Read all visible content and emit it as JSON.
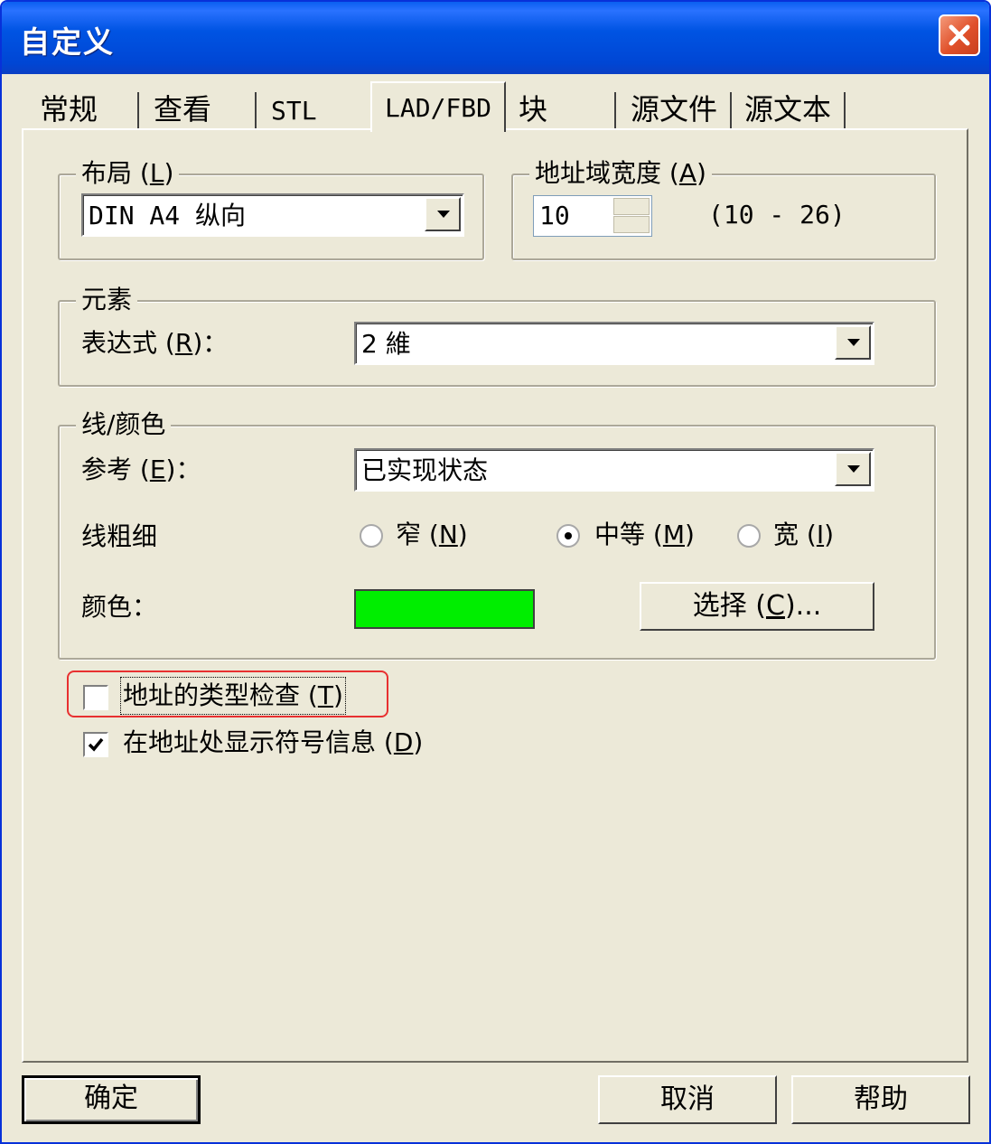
{
  "window": {
    "title": "自定义"
  },
  "tabs": [
    {
      "label": "常规"
    },
    {
      "label": "查看"
    },
    {
      "label": "STL"
    },
    {
      "label": "LAD/FBD"
    },
    {
      "label": "块"
    },
    {
      "label": "源文件"
    },
    {
      "label": "源文本"
    }
  ],
  "active_tab": "LAD/FBD",
  "layout_group": {
    "legend": "布局",
    "mnemonic": "L",
    "selected": "DIN A4 纵向"
  },
  "address_width_group": {
    "legend": "地址域宽度",
    "mnemonic": "A",
    "value": "10",
    "range": "(10 - 26)"
  },
  "elements_group": {
    "legend": "元素",
    "representation_label": "表达式",
    "mnemonic": "R",
    "selected": "2 維"
  },
  "lines_colors_group": {
    "legend": "线/颜色",
    "reference_label": "参考",
    "reference_mnemonic": "E",
    "reference_selected": "已实现状态",
    "thickness_label": "线粗细",
    "thickness_options": [
      {
        "label": "窄",
        "mnemonic": "N",
        "selected": false
      },
      {
        "label": "中等",
        "mnemonic": "M",
        "selected": true
      },
      {
        "label": "宽",
        "mnemonic": "I",
        "selected": false
      }
    ],
    "color_label": "颜色：",
    "color_value": "#00ee00",
    "choose_button": {
      "label": "选择",
      "mnemonic": "C",
      "suffix": "..."
    }
  },
  "checkboxes": [
    {
      "label": "地址的类型检查",
      "mnemonic": "T",
      "checked": false
    },
    {
      "label": "在地址处显示符号信息",
      "mnemonic": "D",
      "checked": true
    }
  ],
  "buttons": {
    "ok": "确定",
    "cancel": "取消",
    "help": "帮助"
  },
  "colors": {
    "title_bar": "#0054e3",
    "dialog_bg": "#ece9d8",
    "highlight_box": "#e83030"
  }
}
